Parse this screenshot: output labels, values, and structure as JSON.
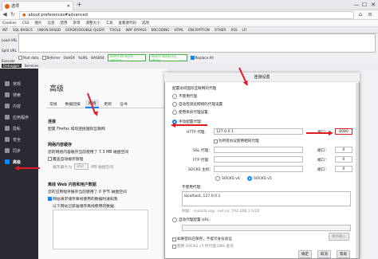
{
  "browser": {
    "tab_title": "选项",
    "url": "about:preferences#advanced",
    "new_tab": "+",
    "window_controls": [
      "—",
      "☐",
      "✕"
    ],
    "bookmarks": [
      "Cookies",
      "CSS",
      "图片",
      "信息",
      "禁用",
      "杂项",
      "调整大小",
      "工具",
      "查看源代码",
      "选项"
    ]
  },
  "hackbar": {
    "menu": [
      "INT",
      "SQL BASICS",
      "UNION BASED",
      "ERROR/DOUBLE QUERY",
      "TOOLS",
      "WAF BYPASS",
      "ENCODING",
      "HTML",
      "ENCRYPTION",
      "OTHER",
      "XSS",
      "LFI"
    ],
    "side": [
      "Load URL",
      "Split URL",
      "Execute"
    ],
    "options": [
      "Post data",
      "Referrer",
      "OxHEX",
      "%URL",
      "BASE64"
    ],
    "insert_replace": "Insert string to replace",
    "insert_replacing": "Insert replacing string",
    "replace_all": "Replace All",
    "dev_strip": [
      "Debugger",
      "Services"
    ]
  },
  "sidebar": {
    "items": [
      {
        "label": "常规",
        "icon": "gear-icon"
      },
      {
        "label": "搜索",
        "icon": "search-icon"
      },
      {
        "label": "内容",
        "icon": "document-icon"
      },
      {
        "label": "应用程序",
        "icon": "apps-icon"
      },
      {
        "label": "隐私",
        "icon": "mask-icon"
      },
      {
        "label": "安全",
        "icon": "lock-icon"
      },
      {
        "label": "同步",
        "icon": "sync-icon"
      },
      {
        "label": "高级",
        "icon": "wizard-icon"
      }
    ],
    "active_index": 7
  },
  "settings": {
    "title": "高级",
    "tabs": [
      "常规",
      "数据回报",
      "网络",
      "更新",
      "证书"
    ],
    "active_tab": 2,
    "connection_header": "连接",
    "connection_desc": "配置 Firefox 如何连接国际互联网",
    "cache_header": "网络内容缓存",
    "cache_desc": "您的网络内容缓存当前使用了 7.3 MB 磁盘空间",
    "cache_override": "覆盖自动缓存管理",
    "cache_limit_label": "缓存最大为",
    "cache_limit_value": "350",
    "cache_limit_unit": "MB 磁盘空间",
    "offline_header": "离线 Web 内容和用户数据",
    "offline_desc": "您的应用程序缓存当前使用了 0 字节 磁盘空间",
    "offline_notify": "网站请求储存离线使用的数据时通知我",
    "offline_allowed": "以下网站已获准储存离线使用的数据："
  },
  "dialog": {
    "title": "连接设置",
    "proxy_header": "配置访问国际互联网的代理",
    "no_proxy": "不使用代理",
    "auto_detect": "自动检测此网络的代理设置",
    "system_proxy": "使用系统代理设置",
    "manual_proxy": "手动配置代理：",
    "http_label": "HTTP 代理：",
    "http_value": "127.0.0.1",
    "port_label": "端口：",
    "http_port": "8080",
    "use_all": "为所有协议使用相同代理",
    "ssl_label": "SSL 代理：",
    "ftp_label": "FTP 代理：",
    "socks_label": "SOCKS 主机：",
    "other_ports": [
      "0",
      "0",
      "0"
    ],
    "socks_v4": "SOCKS v4",
    "socks_v5": "SOCKS v5",
    "no_proxy_for": "不使用代理：",
    "no_proxy_value": "localhost, 127.0.0.1",
    "example": "例如：.mozilla.org, .net.nz, 192.168.1.0/24",
    "auto_url": "自动代理配置 URL：",
    "reload": "重新载入",
    "no_prompt": "如果密码已保存，不提示身份验证",
    "remote_dns": "使用 SOCKS v5 时代理 DNS 查询",
    "ok": "确定",
    "cancel": "取消",
    "help": "帮助"
  },
  "colors": {
    "accent": "#0a84ff",
    "annotation": "#e01b24",
    "sidebar": "#2b2a33"
  }
}
